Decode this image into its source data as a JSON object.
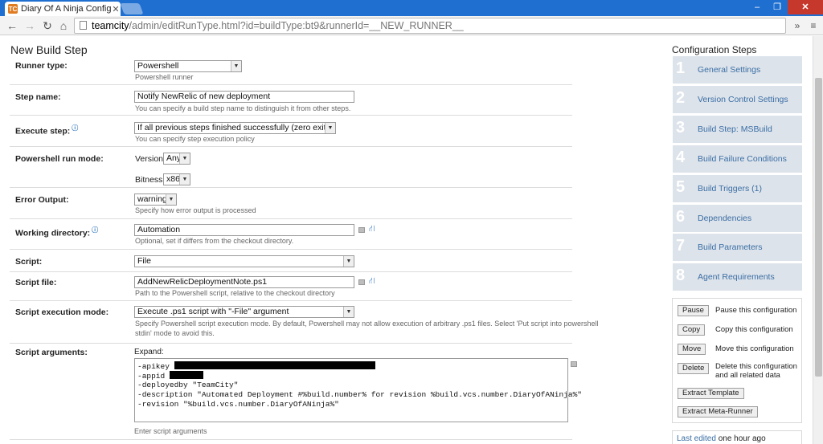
{
  "browser": {
    "tab_title": "Diary Of A Ninja Configura",
    "url_host": "teamcity",
    "url_path": "/admin/editRunType.html?id=buildType:bt9&runnerId=__NEW_RUNNER__"
  },
  "page": {
    "title": "New Build Step",
    "runner_type": {
      "label": "Runner type:",
      "value": "Powershell",
      "hint": "Powershell runner"
    },
    "step_name": {
      "label": "Step name:",
      "value": "Notify NewRelic of new deployment",
      "hint": "You can specify a build step name to distinguish it from other steps."
    },
    "execute_step": {
      "label": "Execute step:",
      "value": "If all previous steps finished successfully (zero exit code)",
      "hint": "You can specify step execution policy"
    },
    "run_mode": {
      "label": "Powershell run mode:",
      "version_label": "Version:",
      "version_value": "Any",
      "bitness_label": "Bitness:",
      "bitness_value": "x86"
    },
    "error_output": {
      "label": "Error Output:",
      "value": "warning",
      "hint": "Specify how error output is processed"
    },
    "working_dir": {
      "label": "Working directory:",
      "value": "Automation",
      "hint": "Optional, set if differs from the checkout directory."
    },
    "script": {
      "label": "Script:",
      "value": "File"
    },
    "script_file": {
      "label": "Script file:",
      "value": "AddNewRelicDeploymentNote.ps1",
      "hint": "Path to the Powershell script, relative to the checkout directory"
    },
    "exec_mode": {
      "label": "Script execution mode:",
      "value": "Execute .ps1 script with \"-File\" argument",
      "hint1": "Specify Powershell script execution mode. By default, Powershell may not allow execution of arbitrary .ps1 files. Select 'Put script into powershell",
      "hint2": "stdin' mode to avoid this."
    },
    "script_args": {
      "label": "Script arguments:",
      "expand": "Expand:",
      "lines": [
        "-apikey ",
        "-appid ",
        "-deployedby \"TeamCity\"",
        "-description \"Automated Deployment #%build.number% for revision %build.vcs.number.DiaryOfANinja%\"",
        "-revision \"%build.vcs.number.DiaryOfANinja%\""
      ],
      "hint": "Enter script arguments"
    }
  },
  "sidebar": {
    "title": "Configuration Steps",
    "steps": [
      {
        "num": "1",
        "label": "General Settings"
      },
      {
        "num": "2",
        "label": "Version Control Settings"
      },
      {
        "num": "3",
        "label": "Build Step: MSBuild"
      },
      {
        "num": "4",
        "label": "Build Failure Conditions"
      },
      {
        "num": "5",
        "label": "Build Triggers (1)"
      },
      {
        "num": "6",
        "label": "Dependencies"
      },
      {
        "num": "7",
        "label": "Build Parameters"
      },
      {
        "num": "8",
        "label": "Agent Requirements"
      }
    ],
    "actions": {
      "pause": {
        "btn": "Pause",
        "desc": "Pause this configuration"
      },
      "copy": {
        "btn": "Copy",
        "desc": "Copy this configuration"
      },
      "move": {
        "btn": "Move",
        "desc": "Move this configuration"
      },
      "delete": {
        "btn": "Delete",
        "desc1": "Delete this configuration",
        "desc2": "and all related data"
      },
      "extract_template": "Extract Template",
      "extract_meta_runner": "Extract Meta-Runner"
    },
    "last_edited": {
      "link": "Last edited",
      "text": " one hour ago"
    }
  }
}
